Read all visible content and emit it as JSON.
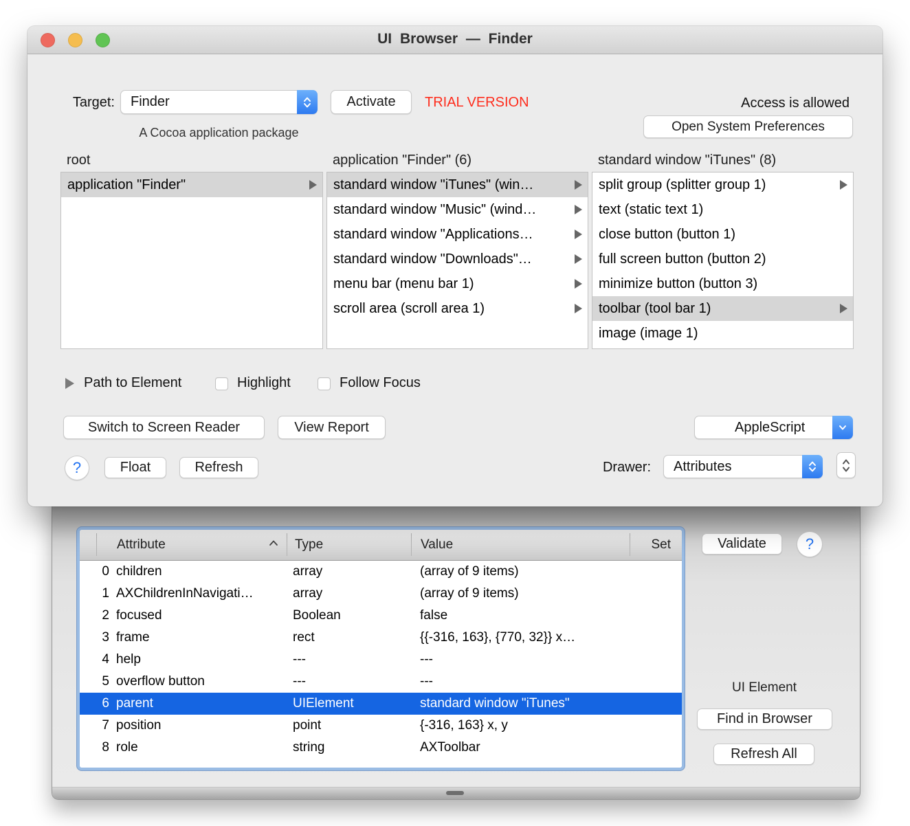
{
  "window": {
    "title": "UI Browser — Finder"
  },
  "target": {
    "label": "Target:",
    "value": "Finder",
    "activate": "Activate",
    "trial": "TRIAL VERSION",
    "access": "Access is allowed",
    "package": "A Cocoa application package",
    "open_prefs": "Open System Preferences"
  },
  "browser": {
    "columns": [
      {
        "header": "root",
        "items": [
          {
            "label": "application \"Finder\"",
            "selected": true,
            "arrow": true
          }
        ]
      },
      {
        "header": "application \"Finder\" (6)",
        "items": [
          {
            "label": "standard window \"iTunes\" (win…",
            "selected": true,
            "arrow": true
          },
          {
            "label": "standard window \"Music\" (wind…",
            "arrow": true
          },
          {
            "label": "standard window \"Applications…",
            "arrow": true
          },
          {
            "label": "standard window \"Downloads\"…",
            "arrow": true
          },
          {
            "label": "menu bar (menu bar 1)",
            "arrow": true
          },
          {
            "label": "scroll area (scroll area 1)",
            "arrow": true
          }
        ]
      },
      {
        "header": "standard window \"iTunes\" (8)",
        "items": [
          {
            "label": "split group (splitter group 1)",
            "arrow": true
          },
          {
            "label": "text (static text 1)"
          },
          {
            "label": "close button (button 1)"
          },
          {
            "label": "full screen button (button 2)"
          },
          {
            "label": "minimize button (button 3)"
          },
          {
            "label": "toolbar (tool bar 1)",
            "selected": true,
            "arrow": true
          },
          {
            "label": "image (image 1)"
          }
        ]
      }
    ]
  },
  "controls": {
    "path_to_element": "Path to Element",
    "highlight": "Highlight",
    "follow_focus": "Follow Focus",
    "switch_reader": "Switch to Screen Reader",
    "view_report": "View Report",
    "applescript": "AppleScript",
    "help": "?",
    "float": "Float",
    "refresh": "Refresh",
    "drawer_label": "Drawer:",
    "drawer_value": "Attributes"
  },
  "drawer": {
    "table": {
      "headers": {
        "attribute": "Attribute",
        "type": "Type",
        "value": "Value",
        "set": "Set"
      },
      "rows": [
        {
          "index": "0",
          "attribute": "children",
          "type": "array",
          "value": "(array of 9 items)"
        },
        {
          "index": "1",
          "attribute": "AXChildrenInNavigati…",
          "type": "array",
          "value": "(array of 9 items)"
        },
        {
          "index": "2",
          "attribute": "focused",
          "type": "Boolean",
          "value": "false"
        },
        {
          "index": "3",
          "attribute": "frame",
          "type": "rect",
          "value": "{{-316, 163}, {770, 32}} x…"
        },
        {
          "index": "4",
          "attribute": "help",
          "type": "---",
          "value": "---"
        },
        {
          "index": "5",
          "attribute": "overflow button",
          "type": "---",
          "value": "---"
        },
        {
          "index": "6",
          "attribute": "parent",
          "type": "UIElement",
          "value": "standard window \"iTunes\"",
          "selected": true
        },
        {
          "index": "7",
          "attribute": "position",
          "type": "point",
          "value": "{-316, 163} x, y"
        },
        {
          "index": "8",
          "attribute": "role",
          "type": "string",
          "value": "AXToolbar"
        }
      ]
    },
    "validate": "Validate",
    "help": "?",
    "ui_element": "UI Element",
    "find_in_browser": "Find in Browser",
    "refresh_all": "Refresh All"
  },
  "icons": {
    "target_popup": "chevron-up-down-icon",
    "applescript_popup": "chevron-down-icon",
    "attributes_popup": "chevron-up-down-icon",
    "path_disclosure": "triangle-right-icon",
    "browser_child": "triangle-right-icon",
    "table_sort": "chevron-up-icon",
    "drawer_resize": "resize-handle-icon"
  },
  "colors": {
    "selection_blue": "#1565e2",
    "accent_blue": "#2d7af0",
    "trial_red": "#fe2c1c",
    "browser_selection_gray": "#d6d6d6",
    "window_bg": "#ececec",
    "traffic_red": "#ee6a5f",
    "traffic_yellow": "#f5bd4f",
    "traffic_green": "#61c454",
    "focus_ring_blue": "#9abce4"
  }
}
